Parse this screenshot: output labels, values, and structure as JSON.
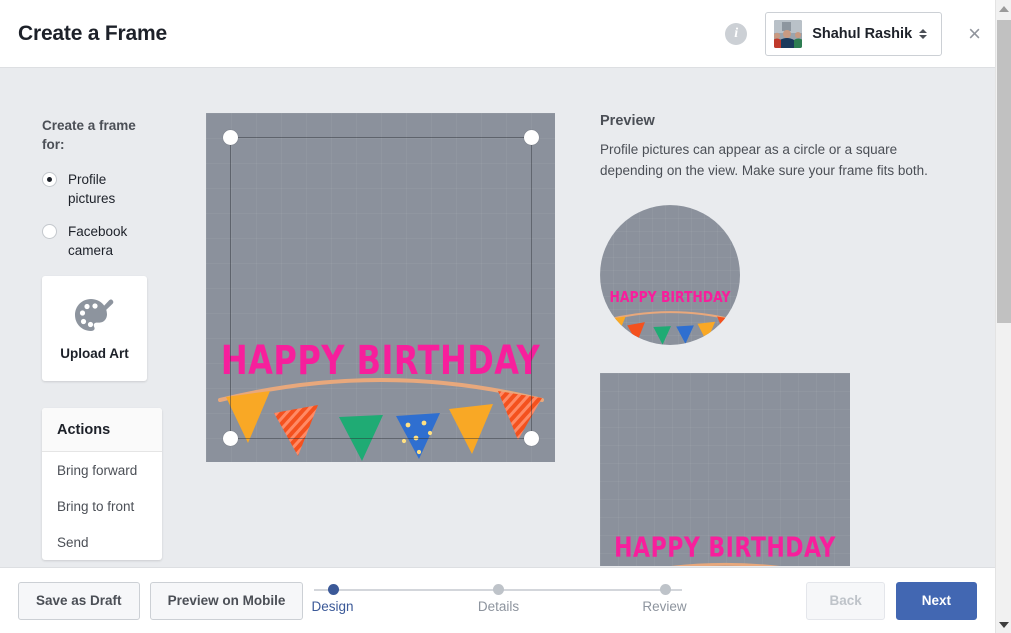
{
  "header": {
    "title": "Create a Frame",
    "info_icon": "info-icon",
    "user_name": "Shahul Rashik",
    "close_label": "×"
  },
  "sidebar": {
    "create_for_label": "Create a frame for:",
    "options": [
      {
        "label": "Profile pictures",
        "selected": true
      },
      {
        "label": "Facebook camera",
        "selected": false
      }
    ],
    "upload": {
      "label": "Upload Art",
      "icon": "palette-brush-icon"
    },
    "actions": {
      "title": "Actions",
      "items": [
        "Bring forward",
        "Bring to front",
        "Send"
      ]
    }
  },
  "canvas": {
    "artwork_text": "HAPPY BIRTHDAY",
    "background_color": "#8b919c",
    "text_color": "#f71f9c",
    "handles": [
      "top-left",
      "top-right",
      "bottom-left",
      "bottom-right"
    ],
    "bunting_colors": [
      "#f9a825",
      "#f4511e",
      "#1fab74",
      "#2f6fd0",
      "#f9a825",
      "#f4511e"
    ],
    "string_color": "#e8a87c"
  },
  "preview": {
    "title": "Preview",
    "description": "Profile pictures can appear as a circle or a square depending on the view. Make sure your frame fits both.",
    "circle_text": "HAPPY BIRTHDAY",
    "square_text": "HAPPY BIRTHDAY"
  },
  "footer": {
    "save_draft_label": "Save as Draft",
    "preview_mobile_label": "Preview on Mobile",
    "back_label": "Back",
    "next_label": "Next",
    "next_color": "#4267b2",
    "steps": [
      {
        "label": "Design",
        "active": true
      },
      {
        "label": "Details",
        "active": false
      },
      {
        "label": "Review",
        "active": false
      }
    ]
  }
}
